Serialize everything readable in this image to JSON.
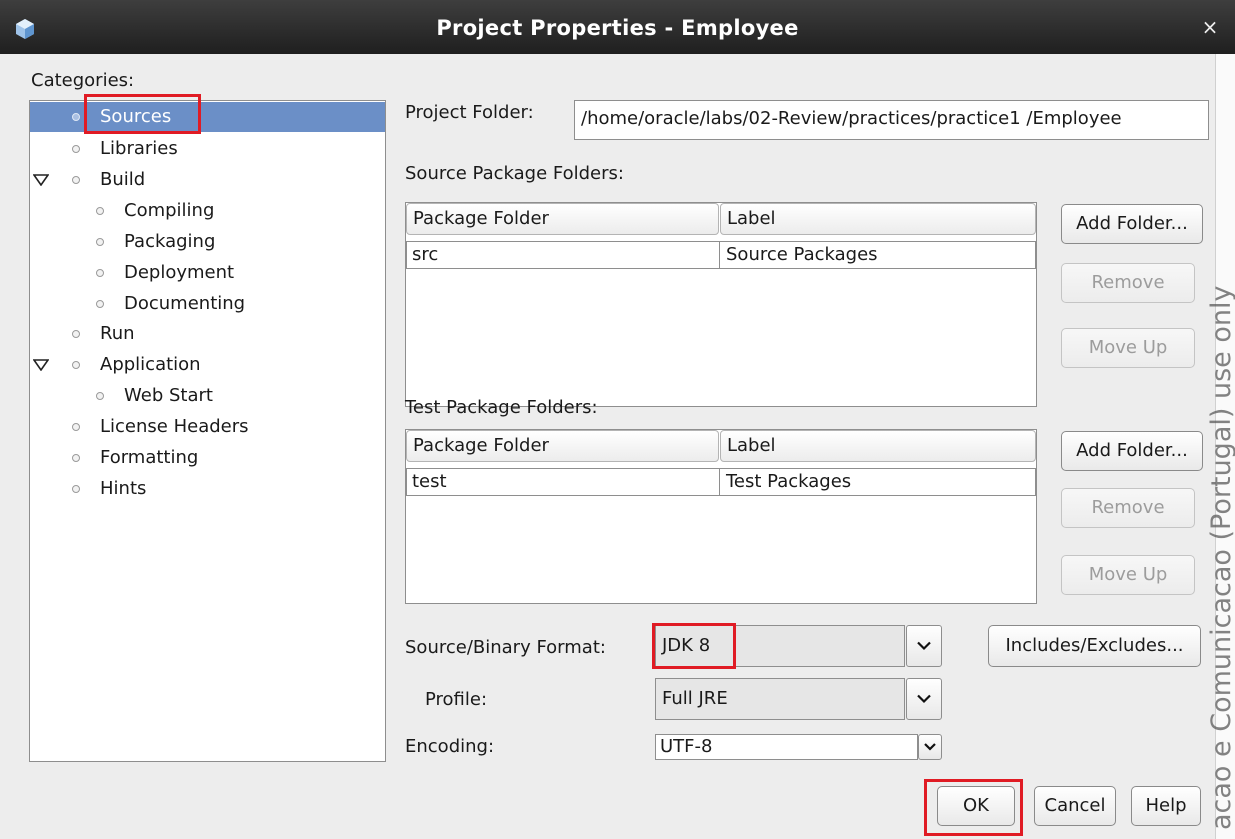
{
  "window": {
    "title": "Project Properties - Employee",
    "close_glyph": "×"
  },
  "categories": {
    "label": "Categories:",
    "items": [
      {
        "label": "Sources",
        "selected": true
      },
      {
        "label": "Libraries"
      },
      {
        "label": "Build",
        "expanded": true
      },
      {
        "label": "Compiling"
      },
      {
        "label": "Packaging"
      },
      {
        "label": "Deployment"
      },
      {
        "label": "Documenting"
      },
      {
        "label": "Run"
      },
      {
        "label": "Application",
        "expanded": true
      },
      {
        "label": "Web Start"
      },
      {
        "label": "License Headers"
      },
      {
        "label": "Formatting"
      },
      {
        "label": "Hints"
      }
    ]
  },
  "project_folder": {
    "label": "Project Folder:",
    "value": "/home/oracle/labs/02-Review/practices/practice1 /Employee"
  },
  "source_folders": {
    "label": "Source Package Folders:",
    "columns": [
      "Package Folder",
      "Label"
    ],
    "rows": [
      [
        "src",
        "Source Packages"
      ]
    ],
    "add_button": "Add Folder...",
    "remove_button": "Remove",
    "move_up_button": "Move Up"
  },
  "test_folders": {
    "label": "Test Package Folders:",
    "columns": [
      "Package Folder",
      "Label"
    ],
    "rows": [
      [
        "test",
        "Test Packages"
      ]
    ],
    "add_button": "Add Folder...",
    "remove_button": "Remove",
    "move_up_button": "Move Up"
  },
  "format": {
    "source_binary_label": "Source/Binary Format:",
    "source_binary_value": "JDK 8",
    "includes_button": "Includes/Excludes...",
    "profile_label": "Profile:",
    "profile_value": "Full JRE",
    "encoding_label": "Encoding:",
    "encoding_value": "UTF-8"
  },
  "buttons": {
    "ok": "OK",
    "cancel": "Cancel",
    "help": "Help"
  },
  "watermark": "acao e Comunicacao (Portugal) use only",
  "colors": {
    "selection": "#6b8fc7",
    "highlight_box": "#e01b24",
    "titlebar": "#2b2b2b"
  }
}
